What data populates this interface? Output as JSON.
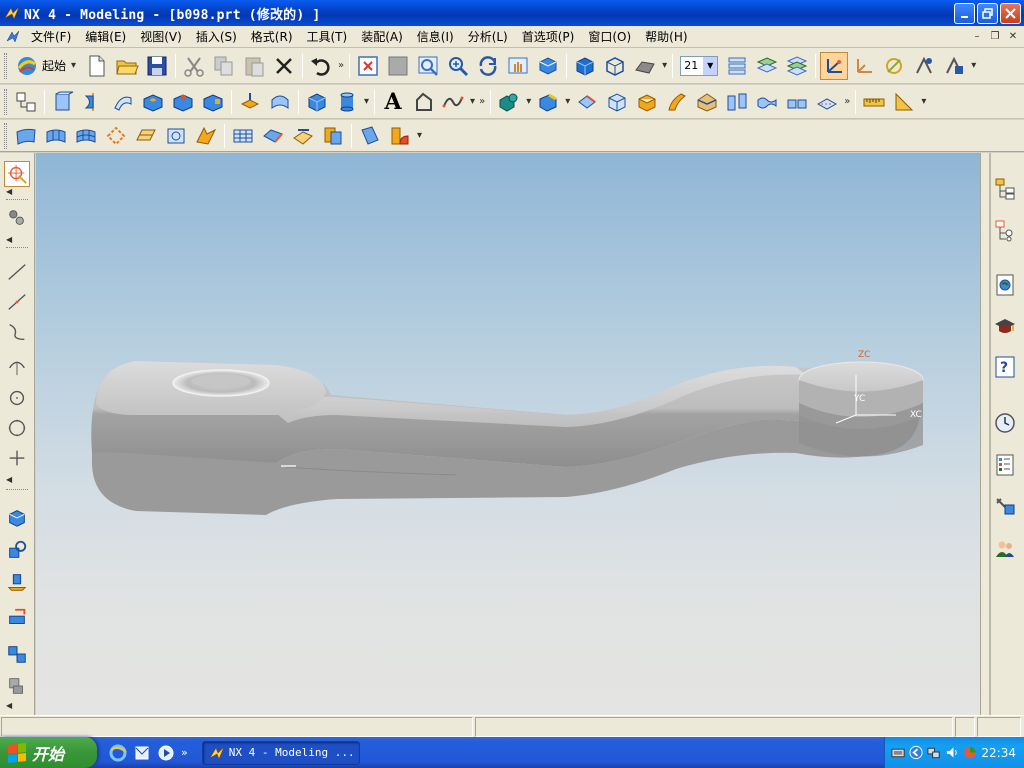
{
  "window": {
    "title": "NX 4 - Modeling - [b098.prt (修改的) ]",
    "buttons": [
      "minimize",
      "restore",
      "close"
    ]
  },
  "menu": {
    "items": [
      "文件(F)",
      "编辑(E)",
      "视图(V)",
      "插入(S)",
      "格式(R)",
      "工具(T)",
      "装配(A)",
      "信息(I)",
      "分析(L)",
      "首选项(P)",
      "窗口(O)",
      "帮助(H)"
    ],
    "mdi_buttons": [
      "minimize",
      "restore",
      "close"
    ]
  },
  "toolbar_standard": {
    "start_label": "起始",
    "layer_value": "21"
  },
  "toolbar_2": {
    "text_icon_label": "A"
  },
  "viewport": {
    "axes": {
      "zc": "ZC",
      "yc": "YC",
      "xc": "XC"
    },
    "colors": {
      "background_top": "#8fb6d6",
      "background_bottom": "#e4e4e2",
      "part": "#b4b4b4",
      "axis_label": "#d5642a"
    }
  },
  "taskbar": {
    "start_label": "开始",
    "task_label": "NX 4 - Modeling ...",
    "clock": "22:34"
  }
}
